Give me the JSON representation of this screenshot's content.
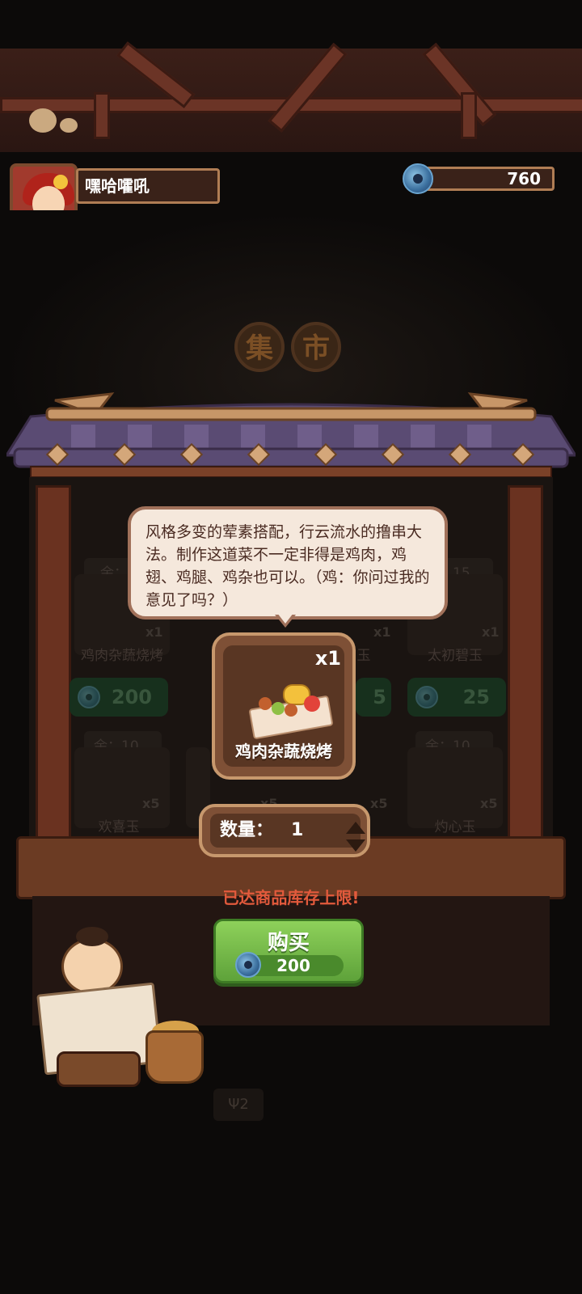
{
  "header": {
    "player_name": "嘿哈嚯吼",
    "currency_amount": "760"
  },
  "market_sign": [
    "集",
    "市"
  ],
  "shelf": {
    "items": [
      {
        "stock_label": "余：",
        "name": "鸡肉杂蔬烧烤",
        "count": "x1",
        "price": "200"
      },
      {
        "stock_label": "",
        "name": "",
        "count": "",
        "price": ""
      },
      {
        "stock_label": "",
        "name": "玉",
        "count": "x1",
        "price": "5"
      },
      {
        "stock_label": "余：15",
        "name": "太初碧玉",
        "count": "x1",
        "price": "25"
      },
      {
        "stock_label": "余：10",
        "name": "欢喜玉",
        "count": "x5",
        "price": ""
      },
      {
        "stock_label": "",
        "name": "",
        "count": "x5",
        "price": ""
      },
      {
        "stock_label": "",
        "name": "",
        "count": "x5",
        "price": ""
      },
      {
        "stock_label": "余：10",
        "name": "灼心玉",
        "count": "x5",
        "price": ""
      }
    ]
  },
  "popup": {
    "description": "风格多变的荤素搭配，行云流水的撸串大法。制作这道菜不一定非得是鸡肉，鸡翅、鸡腿、鸡杂也可以。（鸡：你问过我的意见了吗？）",
    "item_name": "鸡肉杂蔬烧烤",
    "item_count": "x1",
    "quantity_label": "数量：",
    "quantity_value": "1",
    "warning": "已达商品库存上限!",
    "buy_label": "购买",
    "buy_price": "200"
  },
  "vendor_sign": "Ψ2",
  "colors": {
    "accent_green": "#6fb944",
    "warning_red": "#e25a3c",
    "wood": "#7e5036",
    "parchment": "#f5e8dc"
  },
  "icons": [
    "jade-coin-icon",
    "chicken-icon",
    "skewer-icon",
    "arrow-up-icon",
    "arrow-down-icon"
  ]
}
